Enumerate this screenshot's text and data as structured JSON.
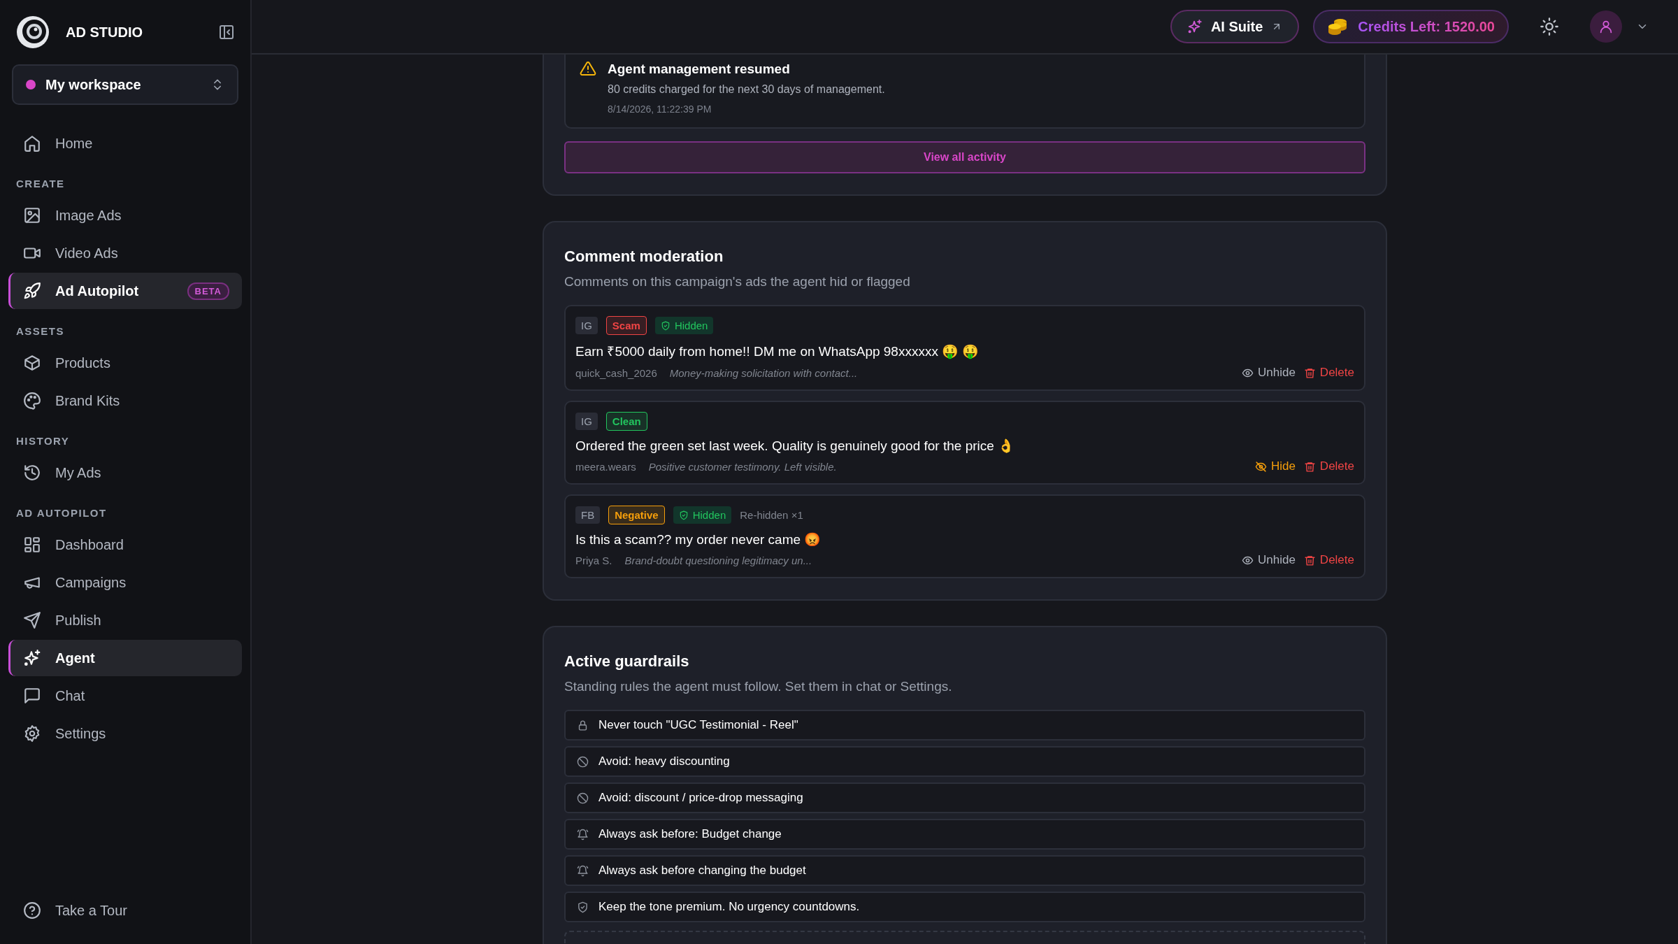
{
  "sidebar": {
    "brand": "AD STUDIO",
    "workspace": "My workspace",
    "sections": [
      {
        "items": [
          {
            "label": "Home",
            "selected": false
          }
        ]
      },
      {
        "label": "CREATE",
        "items": [
          {
            "label": "Image Ads",
            "selected": false
          },
          {
            "label": "Video Ads",
            "selected": false
          },
          {
            "label": "Ad Autopilot",
            "selected": true,
            "badge": "BETA"
          }
        ]
      },
      {
        "label": "ASSETS",
        "items": [
          {
            "label": "Products",
            "selected": false
          },
          {
            "label": "Brand Kits",
            "selected": false
          }
        ]
      },
      {
        "label": "HISTORY",
        "items": [
          {
            "label": "My Ads",
            "selected": false
          }
        ]
      },
      {
        "label": "AD AUTOPILOT",
        "items": [
          {
            "label": "Dashboard",
            "selected": false
          },
          {
            "label": "Campaigns",
            "selected": false
          },
          {
            "label": "Publish",
            "selected": false
          },
          {
            "label": "Agent",
            "selected": true
          },
          {
            "label": "Chat",
            "selected": false
          },
          {
            "label": "Settings",
            "selected": false
          }
        ]
      }
    ],
    "footer": "Take a Tour"
  },
  "top_bar": {
    "ai_suite": "AI Suite",
    "credits": "Credits Left: 1520.00"
  },
  "activity": {
    "item": {
      "title": "Agent management resumed",
      "detail": "80 credits charged for the next 30 days of management.",
      "time": "8/14/2026, 11:22:39 PM"
    },
    "button": "View all activity"
  },
  "comment_moderation": {
    "title": "Comment moderation",
    "subtitle": "Comments on this campaign's ads the agent hid or flagged",
    "comments": [
      {
        "tags": [
          {
            "kind": "platform",
            "text": "IG"
          },
          {
            "kind": "label",
            "text": "Scam",
            "color": "#ef4444"
          },
          {
            "kind": "status",
            "text": "Hidden"
          }
        ],
        "text": "Earn ₹5000 daily from home!! DM me on WhatsApp 98xxxxxx 🤑 🤑",
        "author": "quick_cash_2026",
        "reason": "Money-making solicitation with contact...",
        "actions": [
          {
            "kind": "unhide",
            "text": "Unhide"
          },
          {
            "kind": "delete",
            "text": "Delete"
          }
        ]
      },
      {
        "tags": [
          {
            "kind": "platform",
            "text": "IG"
          },
          {
            "kind": "label",
            "text": "Clean",
            "color": "#22c55e"
          }
        ],
        "text": "Ordered the green set last week. Quality is genuinely good for the price 👌",
        "author": "meera.wears",
        "reason": "Positive customer testimony. Left visible.",
        "actions": [
          {
            "kind": "hide",
            "text": "Hide"
          },
          {
            "kind": "delete",
            "text": "Delete"
          }
        ]
      },
      {
        "tags": [
          {
            "kind": "platform",
            "text": "FB"
          },
          {
            "kind": "label",
            "text": "Negative",
            "color": "#f59e0b"
          },
          {
            "kind": "status",
            "text": "Hidden"
          },
          {
            "kind": "note",
            "text": "Re-hidden ×1"
          }
        ],
        "text": "Is this a scam?? my order never came 😡",
        "author": "Priya S.",
        "reason": "Brand-doubt questioning legitimacy un...",
        "actions": [
          {
            "kind": "unhide",
            "text": "Unhide"
          },
          {
            "kind": "delete",
            "text": "Delete"
          }
        ]
      }
    ]
  },
  "guardrails": {
    "title": "Active guardrails",
    "subtitle": "Standing rules the agent must follow. Set them in chat or Settings.",
    "rules": [
      {
        "kind": "protect",
        "text": "Never touch \"UGC Testimonial - Reel\""
      },
      {
        "kind": "avoid",
        "text": "Avoid: heavy discounting"
      },
      {
        "kind": "avoid",
        "text": "Avoid: discount / price-drop messaging"
      },
      {
        "kind": "ask",
        "text": "Always ask before: Budget change"
      },
      {
        "kind": "ask",
        "text": "Always ask before changing the budget"
      },
      {
        "kind": "rule",
        "text": "Keep the tone premium. No urgency countdowns."
      }
    ]
  }
}
